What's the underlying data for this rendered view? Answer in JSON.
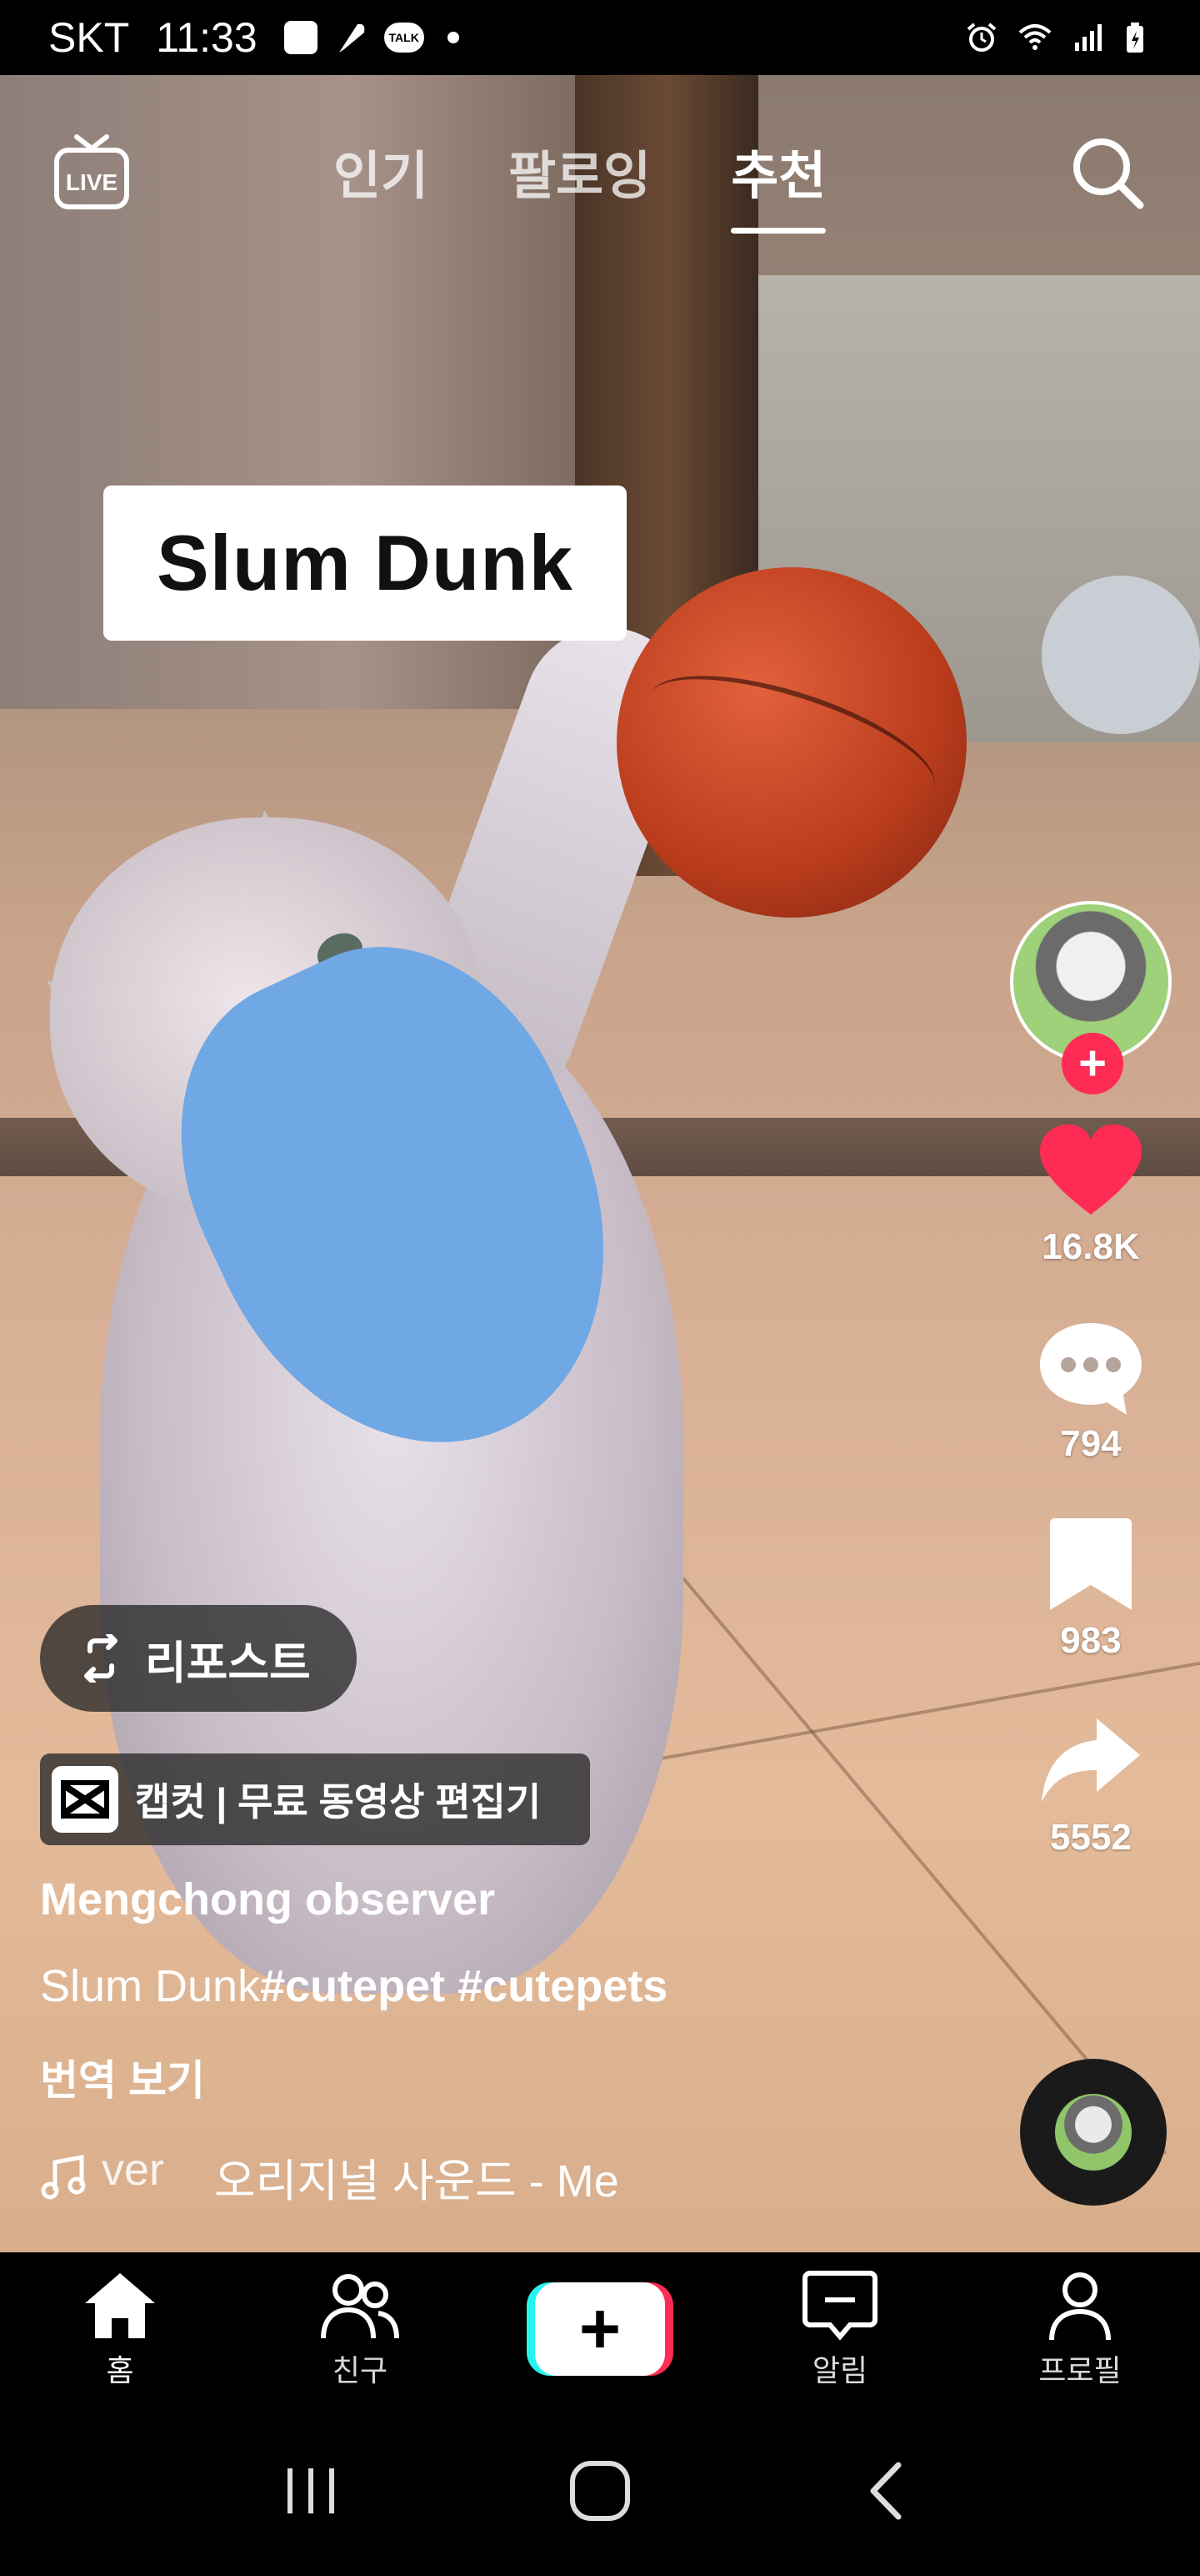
{
  "status_bar": {
    "carrier": "SKT",
    "time": "11:33",
    "talk_badge": "TALK"
  },
  "top_nav": {
    "tabs": [
      {
        "label": "인기",
        "active": false
      },
      {
        "label": "팔로잉",
        "active": false
      },
      {
        "label": "추천",
        "active": true
      }
    ],
    "live_label": "LIVE"
  },
  "video": {
    "caption_overlay": "Slum Dunk"
  },
  "right_rail": {
    "follow_label": "+",
    "likes": "16.8K",
    "comments": "794",
    "bookmarks": "983",
    "shares": "5552"
  },
  "info": {
    "repost_label": "리포스트",
    "capcut_label": "캡컷 | 무료 동영상 편집기",
    "username": "Mengchong observer",
    "description_text": "Slum Dunk",
    "description_tags": "#cutepet #cutepets",
    "translate_label": "번역 보기",
    "music_left": "ver",
    "music_text": "오리지널 사운드 - Me"
  },
  "bottom_nav": {
    "items": [
      {
        "label": "홈",
        "icon": "home-icon",
        "active": true
      },
      {
        "label": "친구",
        "icon": "friends-icon",
        "active": false
      },
      {
        "label": "",
        "icon": "create-icon",
        "active": false
      },
      {
        "label": "알림",
        "icon": "inbox-icon",
        "active": false
      },
      {
        "label": "프로필",
        "icon": "profile-icon",
        "active": false
      }
    ],
    "create_symbol": "+"
  },
  "colors": {
    "accent_red": "#fe2c55",
    "accent_cyan": "#25f4ee",
    "like_heart": "#fe2c55"
  }
}
